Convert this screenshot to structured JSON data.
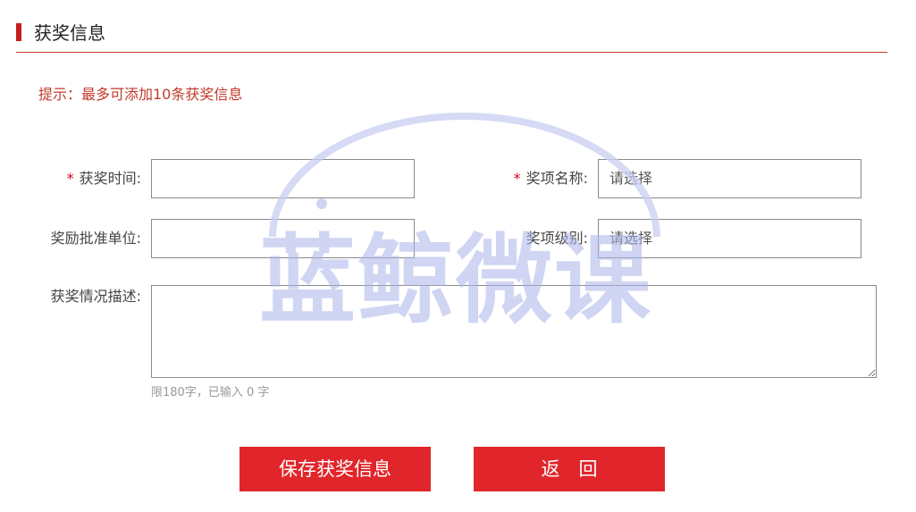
{
  "header": {
    "title": "获奖信息",
    "accent_color": "#c81e1e"
  },
  "hint": "提示：最多可添加10条获奖信息",
  "form": {
    "award_time": {
      "required_mark": "*",
      "label": "获奖时间:",
      "value": ""
    },
    "award_name": {
      "required_mark": "*",
      "label": "奖项名称:",
      "value": "请选择"
    },
    "approving_unit": {
      "label": "奖励批准单位:",
      "value": ""
    },
    "award_level": {
      "label": "奖项级别:",
      "value": "请选择"
    },
    "description": {
      "label": "获奖情况描述:",
      "value": "",
      "counter": "限180字，已输入 0 字"
    }
  },
  "buttons": {
    "save": "保存获奖信息",
    "back": "返　回",
    "color": "#e0262b"
  },
  "watermark": {
    "text": "蓝鲸微课",
    "color": "#aab4ea"
  }
}
